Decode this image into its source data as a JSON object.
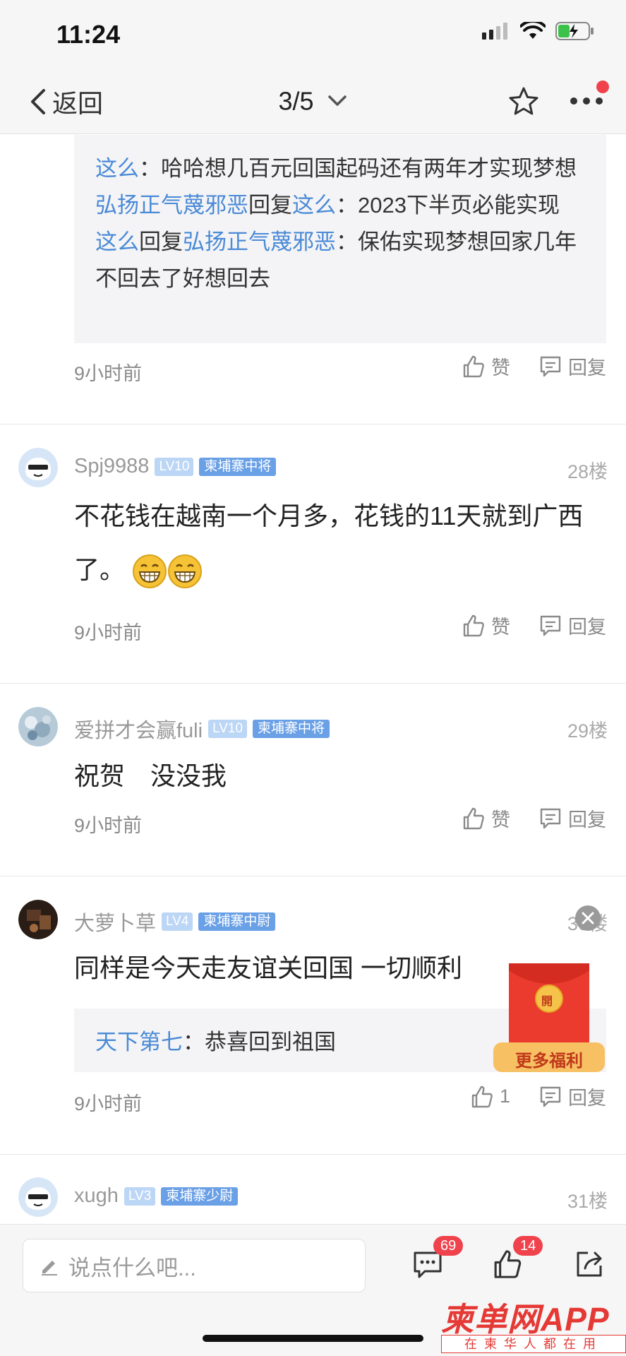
{
  "status_bar": {
    "time": "11:24"
  },
  "nav": {
    "back_label": "返回",
    "page_indicator": "3/5"
  },
  "quote_block": {
    "lines": [
      {
        "user": "这么",
        "text": "：哈哈想几百元回国起码还有两年才实现梦想"
      },
      {
        "user": "弘扬正气蔑邪恶",
        "reply_word": "回复",
        "target": "这么",
        "text": "：2023下半页必能实现"
      },
      {
        "user": "这么",
        "reply_word": "回复",
        "target": "弘扬正气蔑邪恶",
        "text": "：保佑实现梦想回家几年不回去了好想回去"
      }
    ]
  },
  "comment_27": {
    "time": "9小时前",
    "like_label": "赞",
    "reply_label": "回复"
  },
  "comments": [
    {
      "username": "Spj9988",
      "level": "LV10",
      "rank": "柬埔寨中将",
      "floor": "28楼",
      "text": "不花钱在越南一个月多，花钱的11天就到广西了。",
      "time": "9小时前",
      "like_label": "赞",
      "reply_label": "回复"
    },
    {
      "username": "爱拼才会赢fuli",
      "level": "LV10",
      "rank": "柬埔寨中将",
      "floor": "29楼",
      "text": "祝贺　没没我",
      "time": "9小时前",
      "like_label": "赞",
      "reply_label": "回复"
    },
    {
      "username": "大萝卜草",
      "level": "LV4",
      "rank": "柬埔寨中尉",
      "floor": "30楼",
      "text": "同样是今天走友谊关回国 一切顺利",
      "reply_user": "天下第七",
      "reply_text": "：恭喜回到祖国",
      "time": "9小时前",
      "like_count": "1",
      "reply_label": "回复"
    },
    {
      "username": "xugh",
      "level": "LV3",
      "rank": "柬埔寨少尉",
      "floor": "31楼"
    }
  ],
  "promo": {
    "label": "更多福利",
    "seal_char": "開"
  },
  "bottom_bar": {
    "input_placeholder": "说点什么吧...",
    "comment_count": "69",
    "like_count": "14"
  },
  "watermark": {
    "title": "柬单网APP",
    "subtitle": "在柬华人都在用"
  },
  "colors": {
    "accent": "#4a8ad6",
    "badge": "#f0424c",
    "level_bg": "#bcd6f6",
    "rank_bg": "#6aa0e6"
  }
}
